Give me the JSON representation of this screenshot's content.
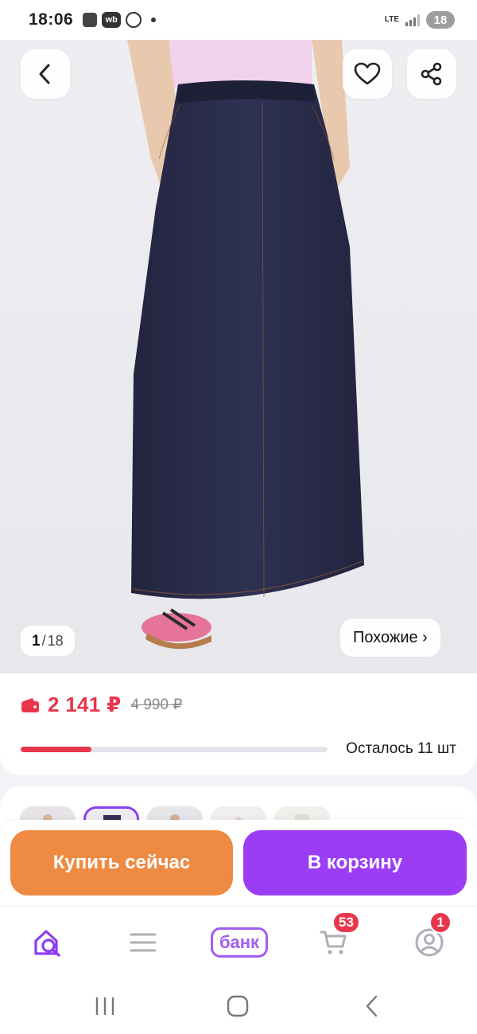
{
  "status_bar": {
    "time": "18:06",
    "notification_icons": [
      "box-icon",
      "wb-icon",
      "whatsapp-icon",
      "dot-icon"
    ],
    "wb_label": "wb",
    "network_label": "LTE",
    "battery_level": "18"
  },
  "product_gallery": {
    "current_index": "1",
    "separator": "/",
    "total_count": "18",
    "similar_label": "Похожие ›",
    "image_description_icons": [
      "back-icon",
      "heart-icon",
      "share-icon"
    ]
  },
  "price": {
    "current": "2 141 ₽",
    "old": "4 990 ₽",
    "stock_label": "Осталось 11 шт",
    "stock_progress": 0.23,
    "accent_color": "#e8364d"
  },
  "thumbnails": {
    "count_visible": 5,
    "active_index": 1
  },
  "actions": {
    "buy_now_label": "Купить сейчас",
    "add_to_cart_label": "В корзину",
    "buy_now_color": "#ef8a43",
    "cart_color": "#9b3df5"
  },
  "bottom_nav": {
    "items": [
      {
        "icon": "home-search-icon"
      },
      {
        "icon": "menu-icon"
      },
      {
        "label": "банк"
      },
      {
        "icon": "cart-icon",
        "badge": "53"
      },
      {
        "icon": "profile-icon",
        "badge": "1"
      }
    ]
  },
  "system_nav": {
    "icons": [
      "recent-apps-icon",
      "home-icon",
      "back-icon"
    ]
  }
}
